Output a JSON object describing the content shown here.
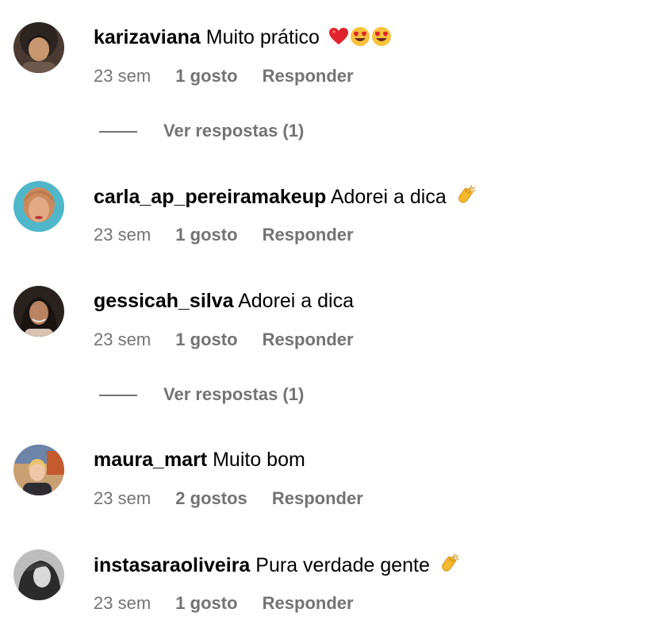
{
  "comments": [
    {
      "username": "karizaviana",
      "text": "Muito prático",
      "emoji_icons": [
        "red-heart-icon",
        "heart-eyes-icon",
        "heart-eyes-icon"
      ],
      "time": "23 sem",
      "likes": "1 gosto",
      "reply": "Responder",
      "view_replies": "Ver respostas (1)"
    },
    {
      "username": "carla_ap_pereiramakeup",
      "text": "Adorei a dica",
      "emoji_icons": [
        "clapping-hands-icon"
      ],
      "time": "23 sem",
      "likes": "1 gosto",
      "reply": "Responder"
    },
    {
      "username": "gessicah_silva",
      "text": "Adorei a dica",
      "time": "23 sem",
      "likes": "1 gosto",
      "reply": "Responder",
      "view_replies": "Ver respostas (1)"
    },
    {
      "username": "maura_mart",
      "text": "Muito bom",
      "time": "23 sem",
      "likes": "2 gostos",
      "reply": "Responder"
    },
    {
      "username": "instasaraoliveira",
      "text": "Pura verdade gente",
      "emoji_icons": [
        "clapping-hands-icon"
      ],
      "time": "23 sem",
      "likes": "1 gosto",
      "reply": "Responder"
    }
  ],
  "colors": {
    "text": "#000000",
    "secondary": "#737373",
    "background": "#ffffff"
  }
}
